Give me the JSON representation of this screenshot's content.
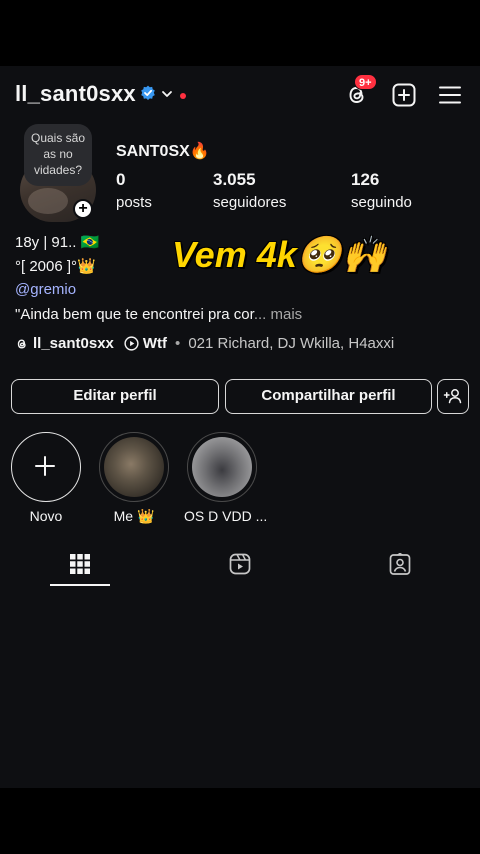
{
  "header": {
    "username": "ll_sant0sxx",
    "notification_badge": "9+",
    "verified_icon": "verified-badge-icon",
    "icons": [
      "threads-icon",
      "create-icon",
      "menu-icon"
    ]
  },
  "profile": {
    "note": "Quais são as no vidades?",
    "display_name": "SANT0SX🔥",
    "stats": [
      {
        "value": "0",
        "label": "posts"
      },
      {
        "value": "3.055",
        "label": "seguidores"
      },
      {
        "value": "126",
        "label": "seguindo"
      }
    ]
  },
  "bio": {
    "line1": "18y | 91.. 🇧🇷",
    "line2": "°[ 2006 ]°👑",
    "mention": "@gremio",
    "quote": "\"Ainda bem que te encontrei pra cor",
    "more": "... mais",
    "threads_handle": "ll_sant0sxx",
    "music_title": "Wtf",
    "music_artists": "021 Richard, DJ Wkilla, H4axxi"
  },
  "overlay_caption": "Vem 4k🥺🙌",
  "buttons": {
    "edit": "Editar perfil",
    "share": "Compartilhar perfil"
  },
  "highlights": [
    {
      "label": "Novo"
    },
    {
      "label": "Me 👑"
    },
    {
      "label": "OS D VDD ..."
    }
  ],
  "tabs": [
    "grid-icon",
    "reels-icon",
    "tagged-icon"
  ],
  "colors": {
    "background": "#0e0f12",
    "accent_mention": "#a5b4ff",
    "badge_red": "#ff3040",
    "verified_blue": "#3897f0",
    "caption_yellow": "#ffd600"
  }
}
